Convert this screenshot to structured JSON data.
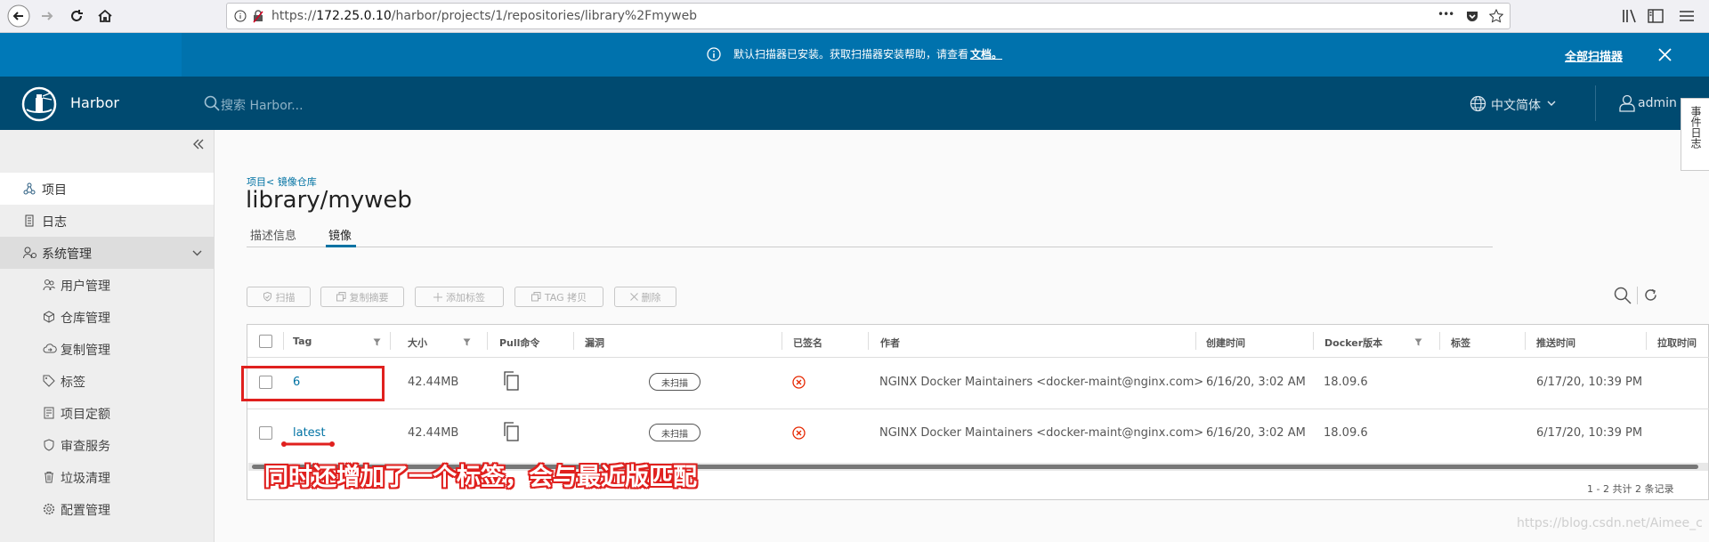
{
  "browser": {
    "url_prefix": "https://",
    "url_host": "172.25.0.10",
    "url_path": "/harbor/projects/1/repositories/library%2Fmyweb",
    "more_label": "•••"
  },
  "banner": {
    "message": "默认扫描器已安装。获取扫描器安装帮助，请查看",
    "link": "文档。",
    "action": "全部扫描器"
  },
  "header": {
    "brand": "Harbor",
    "search_placeholder": "搜索 Harbor...",
    "language": "中文简体",
    "user": "admin"
  },
  "event_log_tab": "事件日志",
  "sidebar": {
    "items": [
      {
        "label": "项目",
        "icon": "project-icon"
      },
      {
        "label": "日志",
        "icon": "log-icon"
      },
      {
        "label": "系统管理",
        "icon": "admin-icon"
      }
    ],
    "sub_items": [
      {
        "label": "用户管理",
        "icon": "users-icon"
      },
      {
        "label": "仓库管理",
        "icon": "cube-icon"
      },
      {
        "label": "复制管理",
        "icon": "cloud-icon"
      },
      {
        "label": "标签",
        "icon": "tag-icon"
      },
      {
        "label": "项目定额",
        "icon": "quota-icon"
      },
      {
        "label": "审查服务",
        "icon": "shield-icon"
      },
      {
        "label": "垃圾清理",
        "icon": "trash-icon"
      },
      {
        "label": "配置管理",
        "icon": "gear-icon"
      }
    ]
  },
  "page": {
    "breadcrumb": "项目< 镜像仓库",
    "title": "library/myweb",
    "tabs": [
      "描述信息",
      "镜像"
    ],
    "active_tab": "镜像"
  },
  "toolbar": {
    "scan": "扫描",
    "copy_digest": "复制摘要",
    "add_label": "添加标签",
    "tag_copy": "TAG 拷贝",
    "delete": "删除"
  },
  "table": {
    "columns": [
      "Tag",
      "大小",
      "Pull命令",
      "漏洞",
      "已签名",
      "作者",
      "创建时间",
      "Docker版本",
      "标签",
      "推送时间",
      "拉取时间"
    ],
    "rows": [
      {
        "tag": "6",
        "size": "42.44MB",
        "vuln": "未扫描",
        "author": "NGINX Docker Maintainers <docker-maint@nginx.com>",
        "created": "6/16/20, 3:02 AM",
        "docker": "18.09.6",
        "pushed": "6/17/20, 10:39 PM"
      },
      {
        "tag": "latest",
        "size": "42.44MB",
        "vuln": "未扫描",
        "author": "NGINX Docker Maintainers <docker-maint@nginx.com>",
        "created": "6/16/20, 3:02 AM",
        "docker": "18.09.6",
        "pushed": "6/17/20, 10:39 PM"
      }
    ],
    "footer": "1 - 2 共计 2 条记录"
  },
  "annotation": "同时还增加了一个标签，会与最近版匹配",
  "watermark": "https://blog.csdn.net/Aimee_c",
  "colors": {
    "banner": "#0079b8",
    "header": "#004a70",
    "link": "#0072a3",
    "annotation": "#e0201e"
  }
}
